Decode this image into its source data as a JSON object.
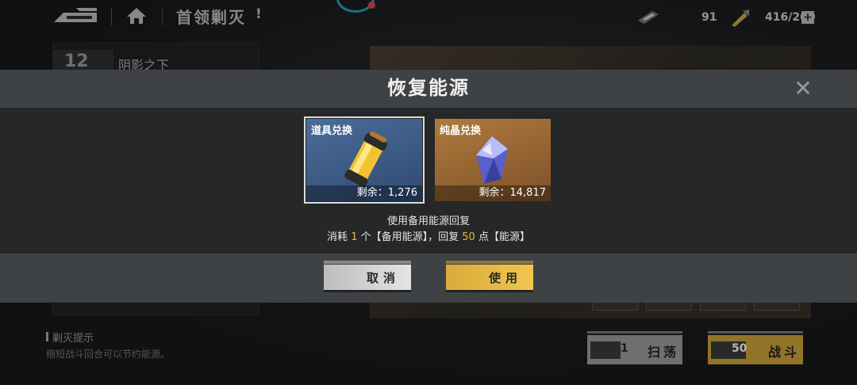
{
  "topbar": {
    "title": "首领剿灭",
    "alert": "!",
    "resource_1_value": "91",
    "resource_2_value": "416/200",
    "plus_label": "+"
  },
  "left_panel": {
    "stage_number": "12",
    "stage_name": "阴影之下"
  },
  "tips": {
    "title": "剿灭提示",
    "body": "缩短战斗回合可以节约能源。"
  },
  "bottom_actions": {
    "sweep": {
      "count": "1",
      "label": "扫荡"
    },
    "battle": {
      "count": "50",
      "label": "战斗"
    }
  },
  "modal": {
    "title": "恢复能源",
    "close": "✕",
    "options": [
      {
        "title": "道具兑换",
        "remaining": "剩余：1,276",
        "selected": true
      },
      {
        "title": "纯晶兑换",
        "remaining": "剩余：14,817",
        "selected": false
      }
    ],
    "desc_line1": "使用备用能源回复",
    "desc_line2": {
      "prefix": "消耗",
      "cost": "1",
      "item": "个【备用能源】，回复",
      "amount": "50",
      "suffix": "点【能源】"
    },
    "cancel_label": "取消",
    "confirm_label": "使用"
  },
  "colors": {
    "accent_yellow": "#e9b83b",
    "modal_bar": "#3f4245",
    "card_blue": "#3b5a84",
    "card_orange": "#9a6a38"
  }
}
